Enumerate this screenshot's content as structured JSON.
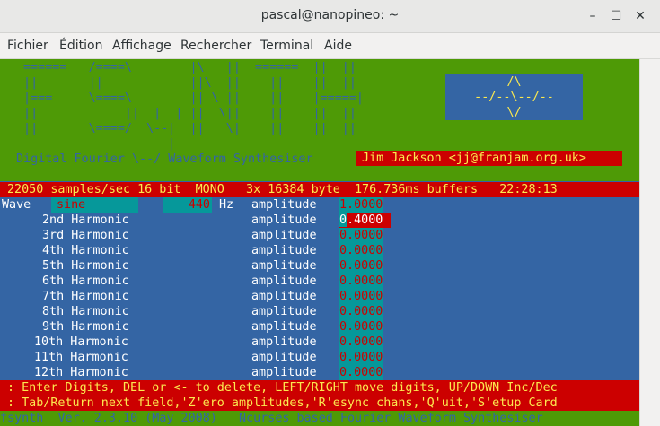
{
  "window": {
    "title": "pascal@nanopineo: ~",
    "menu": [
      "Fichier",
      "Édition",
      "Affichage",
      "Rechercher",
      "Terminal",
      "Aide"
    ]
  },
  "banner": {
    "art": " ======   /====\\        |\\   ||  ======  ||  ||\n ||       ||            ||\\  ||    ||    ||  ||\n |===     \\====\\        || \\ ||    ||    |=====|\n ||            ||  |  | ||  \\||    ||    ||  ||\n ||       \\====/  \\--|  ||   \\|    ||    ||  ||\n                     |",
    "logo": "/\\\n--/--\\--/--\n\\/",
    "tagline": "Digital Fourier \\--/ Waveform Synthesiser",
    "author": "Jim Jackson <jj@franjam.org.uk>"
  },
  "status_line": "22050 samples/sec 16 bit  MONO   3x 16384 byte  176.736ms buffers   22:28:13",
  "wave": {
    "label": "Wave",
    "type": "sine",
    "frequency": "440",
    "unit": "Hz",
    "amp_label": "amplitude",
    "amp_value": "1.0000"
  },
  "harmonics": [
    {
      "label": "2nd Harmonic",
      "amp_label": "amplitude",
      "cursor": "0",
      "rest": ".4000"
    },
    {
      "label": "3rd Harmonic",
      "amp_label": "amplitude",
      "amp": "0.0000"
    },
    {
      "label": "4th Harmonic",
      "amp_label": "amplitude",
      "amp": "0.0000"
    },
    {
      "label": "5th Harmonic",
      "amp_label": "amplitude",
      "amp": "0.0000"
    },
    {
      "label": "6th Harmonic",
      "amp_label": "amplitude",
      "amp": "0.0000"
    },
    {
      "label": "7th Harmonic",
      "amp_label": "amplitude",
      "amp": "0.0000"
    },
    {
      "label": "8th Harmonic",
      "amp_label": "amplitude",
      "amp": "0.0000"
    },
    {
      "label": "9th Harmonic",
      "amp_label": "amplitude",
      "amp": "0.0000"
    },
    {
      "label": "10th Harmonic",
      "amp_label": "amplitude",
      "amp": "0.0000"
    },
    {
      "label": "11th Harmonic",
      "amp_label": "amplitude",
      "amp": "0.0000"
    },
    {
      "label": "12th Harmonic",
      "amp_label": "amplitude",
      "amp": "0.0000"
    }
  ],
  "help": {
    "line1": ": Enter Digits, DEL or <- to delete, LEFT/RIGHT move digits, UP/DOWN Inc/Dec",
    "line2": ": Tab/Return next field,'Z'ero amplitudes,'R'esync chans,'Q'uit,'S'etup Card"
  },
  "footer": "fsynth  Ver. 2.3.10 (May 2008)   Ncurses based Fourier Waveform Synthesiser",
  "colors": {
    "terminal_bg": "#3465a4",
    "banner_bg": "#4e9a06",
    "highlight_red": "#cc0000",
    "highlight_cyan": "#06989a",
    "text_yellow": "#fce94f"
  }
}
